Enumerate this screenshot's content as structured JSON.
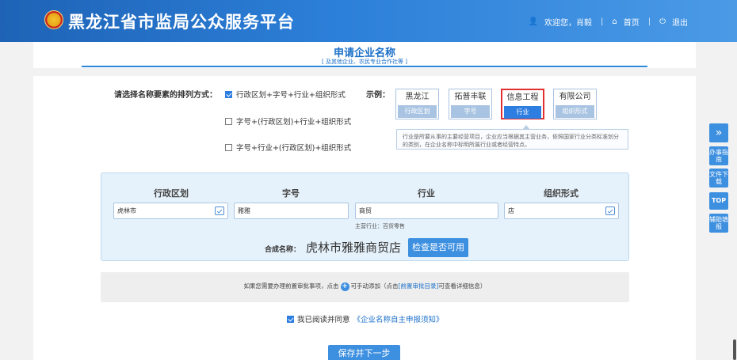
{
  "header": {
    "site_title": "黑龙江省市监局公众服务平台",
    "welcome": "欢迎您，肖毅",
    "home": "首页",
    "logout": "退出",
    "colors": {
      "brand": "#1e63b6",
      "accent": "#3d8fe0"
    }
  },
  "page": {
    "title": "申请企业名称",
    "subtitle": "[ 及其他企业、农民专业合作社等 ]"
  },
  "ordering": {
    "label": "请选择名称要素的排列方式：",
    "options": [
      {
        "label": "行政区划+字号+行业+组织形式",
        "checked": true
      },
      {
        "label": "字号+(行政区划)+行业+组织形式",
        "checked": false
      },
      {
        "label": "字号+行业+(行政区划)+组织形式",
        "checked": false
      }
    ]
  },
  "example": {
    "label": "示例：",
    "boxes": [
      {
        "value": "黑龙江",
        "caption": "行政区划",
        "highlighted": false
      },
      {
        "value": "拓普丰联",
        "caption": "字号",
        "highlighted": false
      },
      {
        "value": "信息工程",
        "caption": "行业",
        "highlighted": true
      },
      {
        "value": "有限公司",
        "caption": "组织形式",
        "highlighted": false
      }
    ],
    "tooltip": "行业是所要从事的主要经营项目，企业应当根据其主营业务，依照国家行业分类标准划分的类别，在企业名称中标明所属行业或者经营特点。"
  },
  "form": {
    "headers": {
      "region": "行政区划",
      "brand": "字号",
      "industry": "行业",
      "org": "组织形式"
    },
    "values": {
      "region": "虎林市",
      "brand": "雅雅",
      "industry": "商贸",
      "org": "店"
    },
    "main_industry": "主营行业：百货零售",
    "combined_label": "合成名称：",
    "combined_value": "虎林市雅雅商贸店",
    "check_button": "检查是否可用"
  },
  "notice": {
    "text_before": "如果您需要办理前置审批事项，点击",
    "text_middle": "可手动添加（点击",
    "link": "[前置审批目录]",
    "text_after": "可查看详细信息）"
  },
  "agreement": {
    "prefix": "我已阅读并同意",
    "link": "《企业名称自主申报须知》",
    "checked": true
  },
  "save_button": "保存并下一步",
  "side_tools": {
    "expand": "»",
    "guide": "办事指南",
    "download": "文件下载",
    "top": "TOP",
    "assist": "辅助填报"
  }
}
